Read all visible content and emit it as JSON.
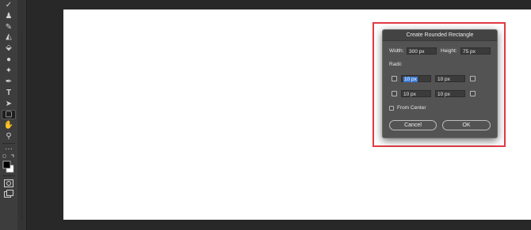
{
  "colors": {
    "highlight": "#e23a45",
    "selection": "#3b79d4",
    "dialog_bg": "#535353",
    "canvas": "#ffffff"
  },
  "toolbar": {
    "tools": [
      {
        "name": "brush-icon",
        "glyph": "✓"
      },
      {
        "name": "stamp-icon",
        "glyph": "♟"
      },
      {
        "name": "history-brush-icon",
        "glyph": "✎"
      },
      {
        "name": "eraser-icon",
        "glyph": "◭"
      },
      {
        "name": "paint-bucket-icon",
        "glyph": "⬙"
      },
      {
        "name": "blur-drop-icon",
        "glyph": "●"
      },
      {
        "name": "dodge-icon",
        "glyph": "✦"
      },
      {
        "name": "pen-icon",
        "glyph": "✒"
      },
      {
        "name": "type-icon",
        "glyph": "T"
      },
      {
        "name": "path-selection-icon",
        "glyph": "➤"
      },
      {
        "name": "rounded-rectangle-tool-icon",
        "glyph": "▢"
      },
      {
        "name": "hand-icon",
        "glyph": "✋"
      },
      {
        "name": "zoom-icon",
        "glyph": "⚲"
      },
      {
        "name": "more-tools-icon",
        "glyph": "···"
      }
    ]
  },
  "dialog": {
    "title": "Create Rounded Rectangle",
    "width_label": "Width:",
    "width_value": "300 px",
    "height_label": "Height:",
    "height_value": "75 px",
    "radii_label": "Radii:",
    "radii": {
      "top_left": "10 px",
      "top_right": "10 px",
      "bottom_left": "10 px",
      "bottom_right": "10 px"
    },
    "from_center_label": "From Center",
    "cancel_label": "Cancel",
    "ok_label": "OK"
  }
}
